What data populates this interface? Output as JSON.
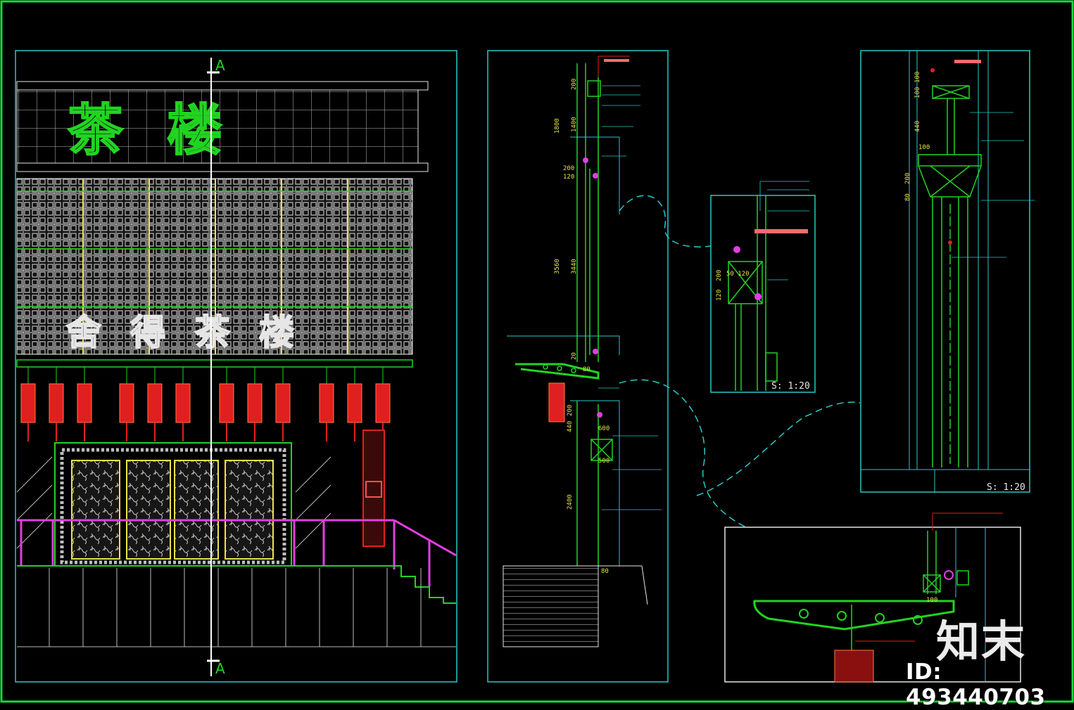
{
  "drawing": {
    "section_marker": "A",
    "sign_main": "茶 楼",
    "sign_sub": "舍 得 茶 楼",
    "scale_detail": "S: 1:20",
    "scale_section": "S: 1:20"
  },
  "dimensions": {
    "vertical_col_a": [
      "200",
      "1800",
      "1400",
      "200",
      "120",
      "3560",
      "3440",
      "20",
      "80",
      "200",
      "440",
      "2400",
      "80"
    ],
    "plan_labels": [
      "600",
      "500"
    ],
    "detail_dims": [
      "200",
      "120",
      "50 120"
    ],
    "right_dims": [
      "100",
      "100",
      "440",
      "100",
      "200",
      "80"
    ],
    "bottom_dims": [
      "100"
    ]
  },
  "watermark": {
    "logo": "知末",
    "id_label": "ID: 493440703"
  },
  "colors": {
    "frame_border": "#19d93a",
    "panel_border": "#27c9c9",
    "green_line": "#22d322",
    "yellow_line": "#e8e34a",
    "magenta_line": "#e23ee2",
    "red_accent": "#e02020",
    "white_line": "#e6e6e6",
    "label_red": "#ff6a6a"
  }
}
